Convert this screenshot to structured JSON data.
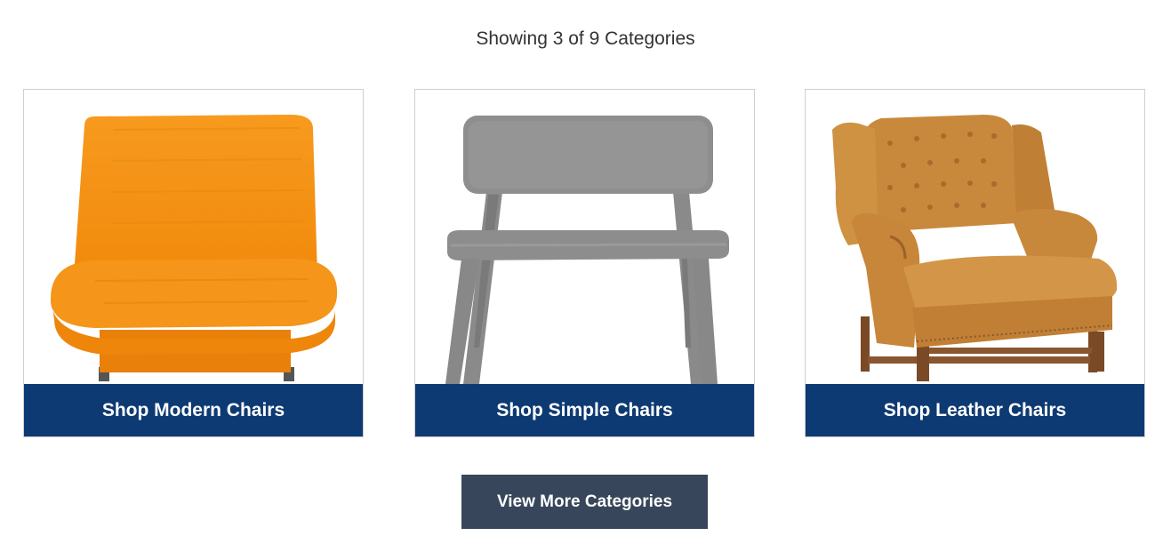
{
  "header": {
    "showing_text": "Showing 3 of 9 Categories"
  },
  "categories": [
    {
      "label": "Shop Modern Chairs",
      "image": "orange-modern-chair"
    },
    {
      "label": "Shop Simple Chairs",
      "image": "gray-simple-chair"
    },
    {
      "label": "Shop Leather Chairs",
      "image": "brown-leather-wingback-chair"
    }
  ],
  "footer": {
    "view_more_label": "View More Categories"
  },
  "colors": {
    "banner": "#0d3a73",
    "button": "#37465a",
    "text": "#333333"
  }
}
